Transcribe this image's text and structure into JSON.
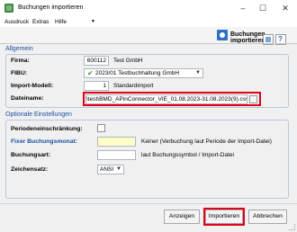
{
  "window": {
    "title": "Buchungen importieren",
    "controls": {
      "minimize": "–",
      "maximize": "☐",
      "close": "✕"
    }
  },
  "menu": {
    "items": [
      "Ausdruck",
      "Extras",
      "Hilfe"
    ],
    "arrow": "▼"
  },
  "header": {
    "title": "Buchungen importieren"
  },
  "sections": {
    "general": {
      "label": "Allgemein",
      "firma": {
        "label": "Firma:",
        "value": "600112",
        "name": "Test GmbH"
      },
      "fibu": {
        "label": "FIBU:",
        "value": "2023/01 Testbuchhaltung GmbH"
      },
      "import_model": {
        "label": "Import-Modell:",
        "value": "1",
        "name": "Standardimport"
      },
      "file": {
        "label": "Dateiname:",
        "value": "\\test\\BMD_APinConnector_VIE_01.08.2023-31.08.2023(9).csv"
      }
    },
    "optional": {
      "label": "Optionale Einstellungen",
      "period_limit": {
        "label": "Periodeneinschränkung:"
      },
      "fixed_month": {
        "label": "Fixer Buchungsmonat:",
        "value": "",
        "hint": "Keiner (Verbuchung laut Periode der Import-Datei)"
      },
      "booking_type": {
        "label": "Buchungsart:",
        "value": "",
        "hint": "laut Buchungssymbol / Import-Datei"
      },
      "charset": {
        "label": "Zeichensatz:",
        "value": "ANSI"
      }
    }
  },
  "buttons": {
    "show": "Anzeigen",
    "import": "Importieren",
    "cancel": "Abbrechen"
  },
  "colors": {
    "highlight": "#e0001a",
    "section_label": "#1a4fa2",
    "required_field": "#ffffc8"
  }
}
